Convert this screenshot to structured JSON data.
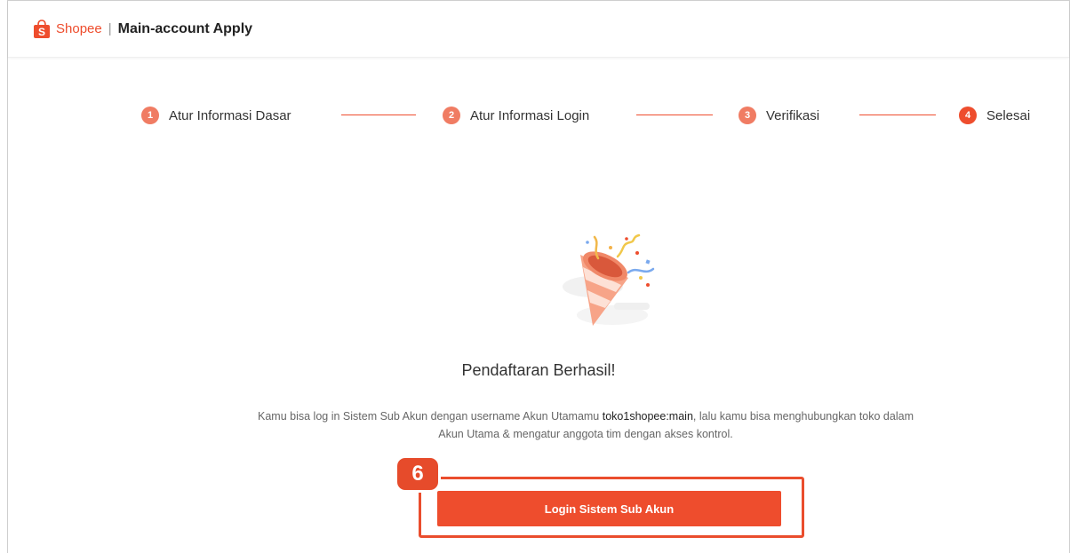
{
  "header": {
    "brand": "Shopee",
    "separator": "|",
    "title": "Main-account Apply"
  },
  "steps": [
    {
      "number": "1",
      "label": "Atur Informasi Dasar"
    },
    {
      "number": "2",
      "label": "Atur Informasi Login"
    },
    {
      "number": "3",
      "label": "Verifikasi"
    },
    {
      "number": "4",
      "label": "Selesai"
    }
  ],
  "result": {
    "title": "Pendaftaran Berhasil!",
    "desc_before": "Kamu bisa log in Sistem Sub Akun dengan username Akun Utamamu ",
    "username": "toko1shopee:main",
    "desc_after": ", lalu kamu bisa menghubungkan toko dalam Akun Utama & mengatur anggota tim dengan akses kontrol."
  },
  "login_button_label": "Login Sistem Sub Akun",
  "callout_number": "6",
  "colors": {
    "brand": "#ee4d2d",
    "step_inactive": "#f07c63"
  },
  "icons": {
    "logo": "shopee-bag-icon",
    "illustration": "party-popper-icon"
  }
}
